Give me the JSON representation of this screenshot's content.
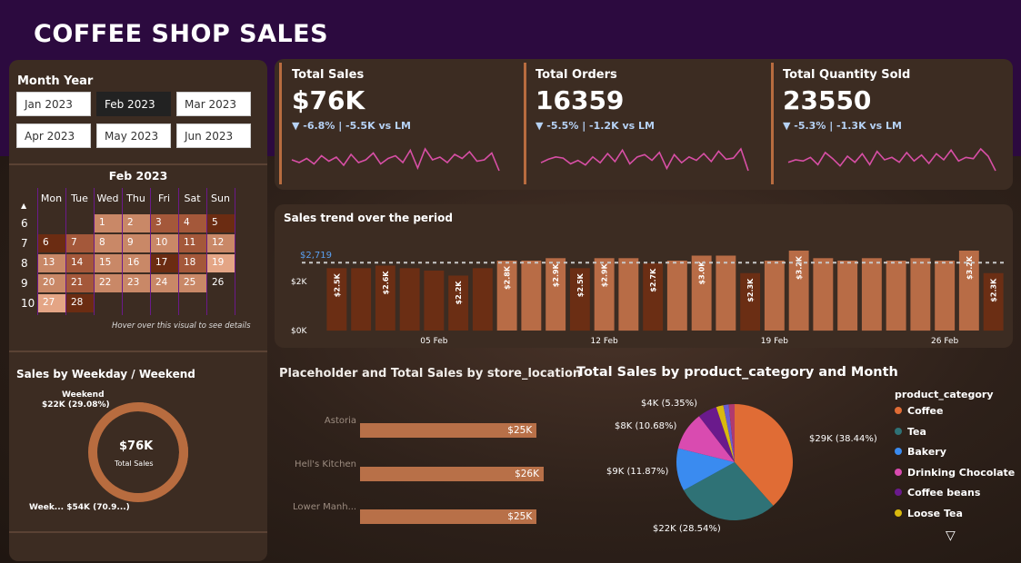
{
  "header": {
    "title": "COFFEE SHOP SALES"
  },
  "slicer": {
    "title": "Month Year",
    "options": [
      "Jan 2023",
      "Feb 2023",
      "Mar 2023",
      "Apr 2023",
      "May 2023",
      "Jun 2023"
    ],
    "selected": "Feb 2023"
  },
  "calendar": {
    "title": "Feb 2023",
    "days": [
      "Mon",
      "Tue",
      "Wed",
      "Thu",
      "Fri",
      "Sat",
      "Sun"
    ],
    "weeks": [
      "6",
      "7",
      "8",
      "9",
      "10"
    ],
    "cells": [
      [
        null,
        null,
        "1",
        "2",
        "3",
        "4",
        "5"
      ],
      [
        "6",
        "7",
        "8",
        "9",
        "10",
        "11",
        "12"
      ],
      [
        "13",
        "14",
        "15",
        "16",
        "17",
        "18",
        "19"
      ],
      [
        "20",
        "21",
        "22",
        "23",
        "24",
        "25",
        "26"
      ],
      [
        "27",
        "28",
        null,
        null,
        null,
        null,
        null
      ]
    ],
    "hover_note": "Hover over this visual to see details",
    "colors": {
      "dark": "#6b2c12",
      "mid": "#a4583a",
      "light": "#c98867",
      "pale": "#e4a585"
    },
    "shade": [
      [
        null,
        null,
        "light",
        "light",
        "mid",
        "mid",
        "dark"
      ],
      [
        "dark",
        "mid",
        "light",
        "light",
        "light",
        "mid",
        "light"
      ],
      [
        "light",
        "mid",
        "light",
        "light",
        "dark",
        "mid",
        "pale"
      ],
      [
        "light",
        "mid",
        "light",
        "light",
        "light",
        "light",
        null
      ],
      [
        "pale",
        "dark",
        null,
        null,
        null,
        null,
        null
      ]
    ]
  },
  "weekday": {
    "title": "Sales by Weekday / Weekend",
    "center_value": "$76K",
    "center_label": "Total Sales",
    "weekend_label": "Weekend",
    "weekend_value": "$22K (29.08%)",
    "weekday_label": "Week... $54K (70.9...)",
    "weekend_share": 0.2908,
    "colors": {
      "weekday": "#b86c3f",
      "weekend": "#ffffff"
    }
  },
  "kpis": [
    {
      "label": "Total Sales",
      "value": "$76K",
      "delta": "▼ -6.8% | -5.5K vs LM",
      "spark": [
        14,
        12,
        15,
        11,
        17,
        13,
        16,
        10,
        18,
        12,
        14,
        19,
        11,
        15,
        17,
        12,
        21,
        8,
        22,
        14,
        16,
        12,
        18,
        15,
        20,
        13,
        14,
        19,
        6
      ]
    },
    {
      "label": "Total Orders",
      "value": "16359",
      "delta": "▼ -5.5% | -1.2K vs LM",
      "spark": [
        9,
        12,
        14,
        13,
        8,
        11,
        7,
        14,
        9,
        17,
        10,
        20,
        8,
        14,
        16,
        11,
        18,
        4,
        16,
        9,
        14,
        11,
        17,
        10,
        19,
        12,
        13,
        21,
        2
      ]
    },
    {
      "label": "Total Quantity Sold",
      "value": "23550",
      "delta": "▼ -5.3% | -1.3K vs LM",
      "spark": [
        8,
        10,
        9,
        12,
        6,
        16,
        11,
        5,
        13,
        8,
        15,
        6,
        17,
        10,
        12,
        8,
        16,
        9,
        14,
        7,
        15,
        10,
        18,
        9,
        12,
        11,
        19,
        13,
        1
      ]
    }
  ],
  "kpi_line_color": "#d84fa6",
  "trend": {
    "title": "Sales trend over the period",
    "avg_label": "$2,719",
    "ytick_top": "$2K",
    "ytick_bottom": "$0K",
    "xticks": [
      "05 Feb",
      "12 Feb",
      "19 Feb",
      "26 Feb"
    ],
    "bar_color_high": "#b86c46",
    "bar_color_low": "#6b2e14"
  },
  "chart_data": {
    "type": "bar",
    "title": "Sales trend over the period",
    "xlabel": "",
    "ylabel": "",
    "categories": [
      "1",
      "2",
      "3",
      "4",
      "5",
      "6",
      "7",
      "8",
      "9",
      "10",
      "11",
      "12",
      "13",
      "14",
      "15",
      "16",
      "17",
      "18",
      "19",
      "20",
      "21",
      "22",
      "23",
      "24",
      "25",
      "26",
      "27",
      "28"
    ],
    "values": [
      2500,
      2500,
      2600,
      2500,
      2400,
      2200,
      2500,
      2800,
      2800,
      2900,
      2500,
      2900,
      2900,
      2700,
      2800,
      3000,
      3000,
      2300,
      2800,
      3200,
      2900,
      2800,
      2900,
      2800,
      2900,
      2800,
      3200,
      2300
    ],
    "labels": [
      "$2.5K",
      "",
      "$2.6K",
      "",
      "",
      "$2.2K",
      "",
      "$2.8K",
      "",
      "$2.9K",
      "$2.5K",
      "$2.9K",
      "",
      "$2.7K",
      "",
      "$3.0K",
      "",
      "$2.3K",
      "",
      "$3.2K",
      "",
      "",
      "",
      "",
      "",
      "",
      "$3.2K",
      "$2.3K"
    ],
    "average": 2719,
    "ylim": [
      0,
      3600
    ]
  },
  "stores": {
    "title": "Placeholder and Total Sales by store_location",
    "items": [
      {
        "name": "Astoria",
        "value": "$25K",
        "amount": 25
      },
      {
        "name": "Hell's Kitchen",
        "value": "$26K",
        "amount": 26
      },
      {
        "name": "Lower Manh...",
        "value": "$25K",
        "amount": 25
      }
    ],
    "max": 26
  },
  "pie": {
    "title": "Total Sales by product_category and Month",
    "legend_title": "product_category",
    "slices": [
      {
        "name": "Coffee",
        "pct": 38.44,
        "label": "$29K (38.44%)",
        "color": "#e06c35"
      },
      {
        "name": "Tea",
        "pct": 28.54,
        "label": "$22K (28.54%)",
        "color": "#2f7276"
      },
      {
        "name": "Bakery",
        "pct": 11.87,
        "label": "$9K (11.87%)",
        "color": "#3a8bf0"
      },
      {
        "name": "Drinking Chocolate",
        "pct": 10.68,
        "label": "$8K (10.68%)",
        "color": "#d94bb0"
      },
      {
        "name": "Coffee beans",
        "pct": 5.35,
        "label": "$4K (5.35%)",
        "color": "#6a1a8c"
      },
      {
        "name": "Loose Tea",
        "pct": 2.0,
        "label": "",
        "color": "#d9b90e"
      },
      {
        "name": "",
        "pct": 1.5,
        "label": "",
        "color": "#6a5ecf"
      },
      {
        "name": "",
        "pct": 1.62,
        "label": "",
        "color": "#b13a6e"
      }
    ]
  }
}
